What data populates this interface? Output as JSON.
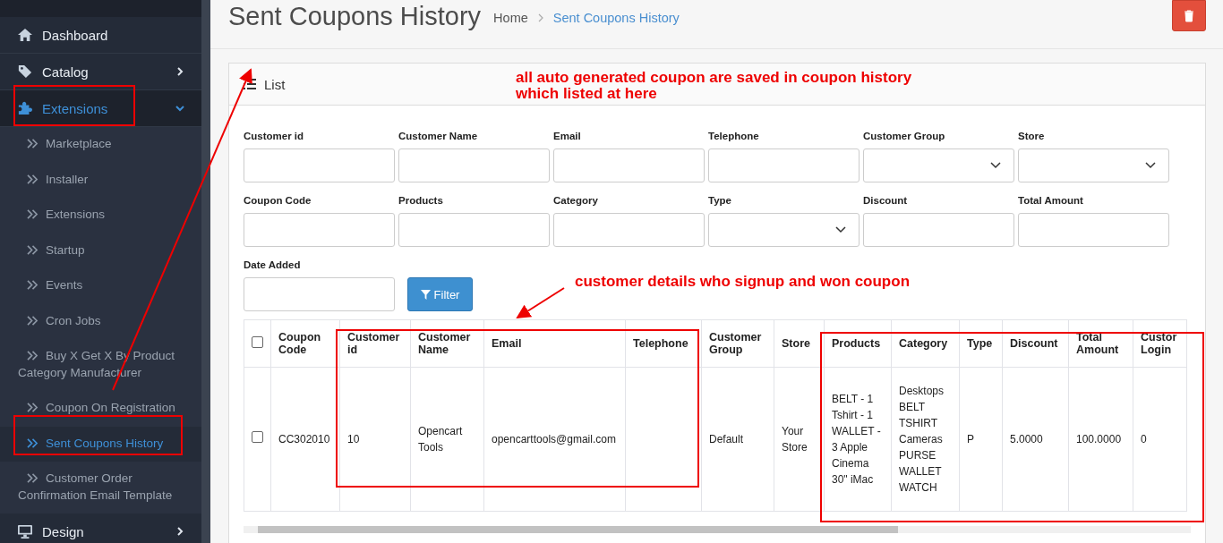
{
  "sidebar": {
    "items": [
      {
        "label": "Dashboard",
        "selected": false
      },
      {
        "label": "Catalog",
        "selected": false,
        "expanded": false
      },
      {
        "label": "Extensions",
        "selected": true,
        "expanded": true,
        "children": [
          {
            "label": "Marketplace",
            "selected": false
          },
          {
            "label": "Installer",
            "selected": false
          },
          {
            "label": "Extensions",
            "selected": false
          },
          {
            "label": "Startup",
            "selected": false
          },
          {
            "label": "Events",
            "selected": false
          },
          {
            "label": "Cron Jobs",
            "selected": false
          },
          {
            "label": "Buy X Get X By Product Category Manufacturer",
            "selected": false
          },
          {
            "label": "Coupon On Registration",
            "selected": false
          },
          {
            "label": "Sent Coupons History",
            "selected": true
          },
          {
            "label": "Customer Order Confirmation Email Template",
            "selected": false
          }
        ]
      },
      {
        "label": "Design",
        "selected": false,
        "expanded": false
      }
    ]
  },
  "page": {
    "title": "Sent Coupons History",
    "breadcrumb": [
      {
        "label": "Home",
        "selected": false
      },
      {
        "label": "Sent Coupons History",
        "selected": true
      }
    ]
  },
  "panel": {
    "title": "List",
    "filters": [
      {
        "label": "Customer id",
        "kind": "text"
      },
      {
        "label": "Customer Name",
        "kind": "text"
      },
      {
        "label": "Email",
        "kind": "text"
      },
      {
        "label": "Telephone",
        "kind": "text"
      },
      {
        "label": "Customer Group",
        "kind": "select"
      },
      {
        "label": "Store",
        "kind": "select"
      },
      {
        "label": "Coupon Code",
        "kind": "text"
      },
      {
        "label": "Products",
        "kind": "text"
      },
      {
        "label": "Category",
        "kind": "text"
      },
      {
        "label": "Type",
        "kind": "select"
      },
      {
        "label": "Discount",
        "kind": "text"
      },
      {
        "label": "Total Amount",
        "kind": "text"
      },
      {
        "label": "Date Added",
        "kind": "text"
      }
    ],
    "filter_button": "Filter",
    "table": {
      "select_all": {
        "checked": false
      },
      "columns": [
        "Coupon Code",
        "Customer id",
        "Customer Name",
        "Email",
        "Telephone",
        "Customer Group",
        "Store",
        "Products",
        "Category",
        "Type",
        "Discount",
        "Total Amount",
        "Custor Login"
      ],
      "rows": [
        {
          "checked": false,
          "cells": [
            "CC302010",
            "10",
            "Opencart Tools",
            "opencarttools@gmail.com",
            "",
            "Default",
            "Your Store",
            "BELT - 1 Tshirt - 1 WALLET - 3 Apple Cinema 30\" iMac",
            "Desktops\nBELT\nTSHIRT\nCameras\nPURSE\nWALLET\nWATCH",
            "P",
            "5.0000",
            "100.0000",
            "0"
          ]
        }
      ]
    }
  },
  "annotations": [
    {
      "text": "all auto generated coupon are saved in coupon history\nwhich listed at here"
    },
    {
      "text": "customer details who signup and won coupon"
    }
  ]
}
